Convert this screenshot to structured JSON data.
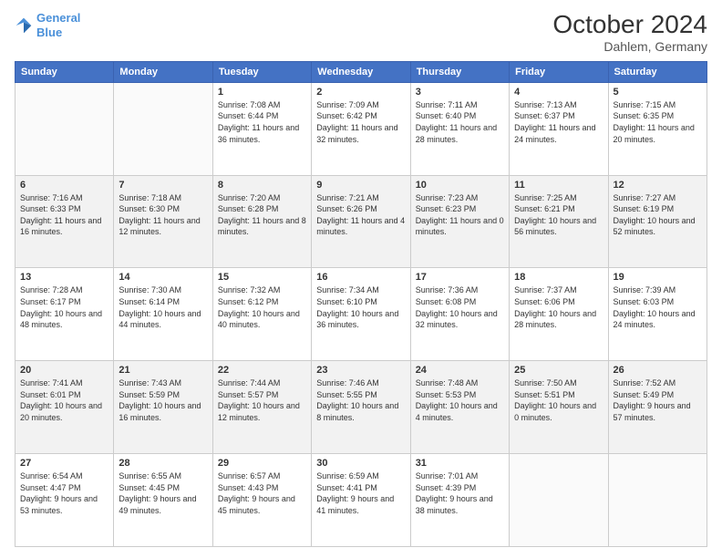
{
  "header": {
    "logo_line1": "General",
    "logo_line2": "Blue",
    "title": "October 2024",
    "subtitle": "Dahlem, Germany"
  },
  "weekdays": [
    "Sunday",
    "Monday",
    "Tuesday",
    "Wednesday",
    "Thursday",
    "Friday",
    "Saturday"
  ],
  "weeks": [
    [
      {
        "day": "",
        "detail": ""
      },
      {
        "day": "",
        "detail": ""
      },
      {
        "day": "1",
        "detail": "Sunrise: 7:08 AM\nSunset: 6:44 PM\nDaylight: 11 hours and 36 minutes."
      },
      {
        "day": "2",
        "detail": "Sunrise: 7:09 AM\nSunset: 6:42 PM\nDaylight: 11 hours and 32 minutes."
      },
      {
        "day": "3",
        "detail": "Sunrise: 7:11 AM\nSunset: 6:40 PM\nDaylight: 11 hours and 28 minutes."
      },
      {
        "day": "4",
        "detail": "Sunrise: 7:13 AM\nSunset: 6:37 PM\nDaylight: 11 hours and 24 minutes."
      },
      {
        "day": "5",
        "detail": "Sunrise: 7:15 AM\nSunset: 6:35 PM\nDaylight: 11 hours and 20 minutes."
      }
    ],
    [
      {
        "day": "6",
        "detail": "Sunrise: 7:16 AM\nSunset: 6:33 PM\nDaylight: 11 hours and 16 minutes."
      },
      {
        "day": "7",
        "detail": "Sunrise: 7:18 AM\nSunset: 6:30 PM\nDaylight: 11 hours and 12 minutes."
      },
      {
        "day": "8",
        "detail": "Sunrise: 7:20 AM\nSunset: 6:28 PM\nDaylight: 11 hours and 8 minutes."
      },
      {
        "day": "9",
        "detail": "Sunrise: 7:21 AM\nSunset: 6:26 PM\nDaylight: 11 hours and 4 minutes."
      },
      {
        "day": "10",
        "detail": "Sunrise: 7:23 AM\nSunset: 6:23 PM\nDaylight: 11 hours and 0 minutes."
      },
      {
        "day": "11",
        "detail": "Sunrise: 7:25 AM\nSunset: 6:21 PM\nDaylight: 10 hours and 56 minutes."
      },
      {
        "day": "12",
        "detail": "Sunrise: 7:27 AM\nSunset: 6:19 PM\nDaylight: 10 hours and 52 minutes."
      }
    ],
    [
      {
        "day": "13",
        "detail": "Sunrise: 7:28 AM\nSunset: 6:17 PM\nDaylight: 10 hours and 48 minutes."
      },
      {
        "day": "14",
        "detail": "Sunrise: 7:30 AM\nSunset: 6:14 PM\nDaylight: 10 hours and 44 minutes."
      },
      {
        "day": "15",
        "detail": "Sunrise: 7:32 AM\nSunset: 6:12 PM\nDaylight: 10 hours and 40 minutes."
      },
      {
        "day": "16",
        "detail": "Sunrise: 7:34 AM\nSunset: 6:10 PM\nDaylight: 10 hours and 36 minutes."
      },
      {
        "day": "17",
        "detail": "Sunrise: 7:36 AM\nSunset: 6:08 PM\nDaylight: 10 hours and 32 minutes."
      },
      {
        "day": "18",
        "detail": "Sunrise: 7:37 AM\nSunset: 6:06 PM\nDaylight: 10 hours and 28 minutes."
      },
      {
        "day": "19",
        "detail": "Sunrise: 7:39 AM\nSunset: 6:03 PM\nDaylight: 10 hours and 24 minutes."
      }
    ],
    [
      {
        "day": "20",
        "detail": "Sunrise: 7:41 AM\nSunset: 6:01 PM\nDaylight: 10 hours and 20 minutes."
      },
      {
        "day": "21",
        "detail": "Sunrise: 7:43 AM\nSunset: 5:59 PM\nDaylight: 10 hours and 16 minutes."
      },
      {
        "day": "22",
        "detail": "Sunrise: 7:44 AM\nSunset: 5:57 PM\nDaylight: 10 hours and 12 minutes."
      },
      {
        "day": "23",
        "detail": "Sunrise: 7:46 AM\nSunset: 5:55 PM\nDaylight: 10 hours and 8 minutes."
      },
      {
        "day": "24",
        "detail": "Sunrise: 7:48 AM\nSunset: 5:53 PM\nDaylight: 10 hours and 4 minutes."
      },
      {
        "day": "25",
        "detail": "Sunrise: 7:50 AM\nSunset: 5:51 PM\nDaylight: 10 hours and 0 minutes."
      },
      {
        "day": "26",
        "detail": "Sunrise: 7:52 AM\nSunset: 5:49 PM\nDaylight: 9 hours and 57 minutes."
      }
    ],
    [
      {
        "day": "27",
        "detail": "Sunrise: 6:54 AM\nSunset: 4:47 PM\nDaylight: 9 hours and 53 minutes."
      },
      {
        "day": "28",
        "detail": "Sunrise: 6:55 AM\nSunset: 4:45 PM\nDaylight: 9 hours and 49 minutes."
      },
      {
        "day": "29",
        "detail": "Sunrise: 6:57 AM\nSunset: 4:43 PM\nDaylight: 9 hours and 45 minutes."
      },
      {
        "day": "30",
        "detail": "Sunrise: 6:59 AM\nSunset: 4:41 PM\nDaylight: 9 hours and 41 minutes."
      },
      {
        "day": "31",
        "detail": "Sunrise: 7:01 AM\nSunset: 4:39 PM\nDaylight: 9 hours and 38 minutes."
      },
      {
        "day": "",
        "detail": ""
      },
      {
        "day": "",
        "detail": ""
      }
    ]
  ]
}
